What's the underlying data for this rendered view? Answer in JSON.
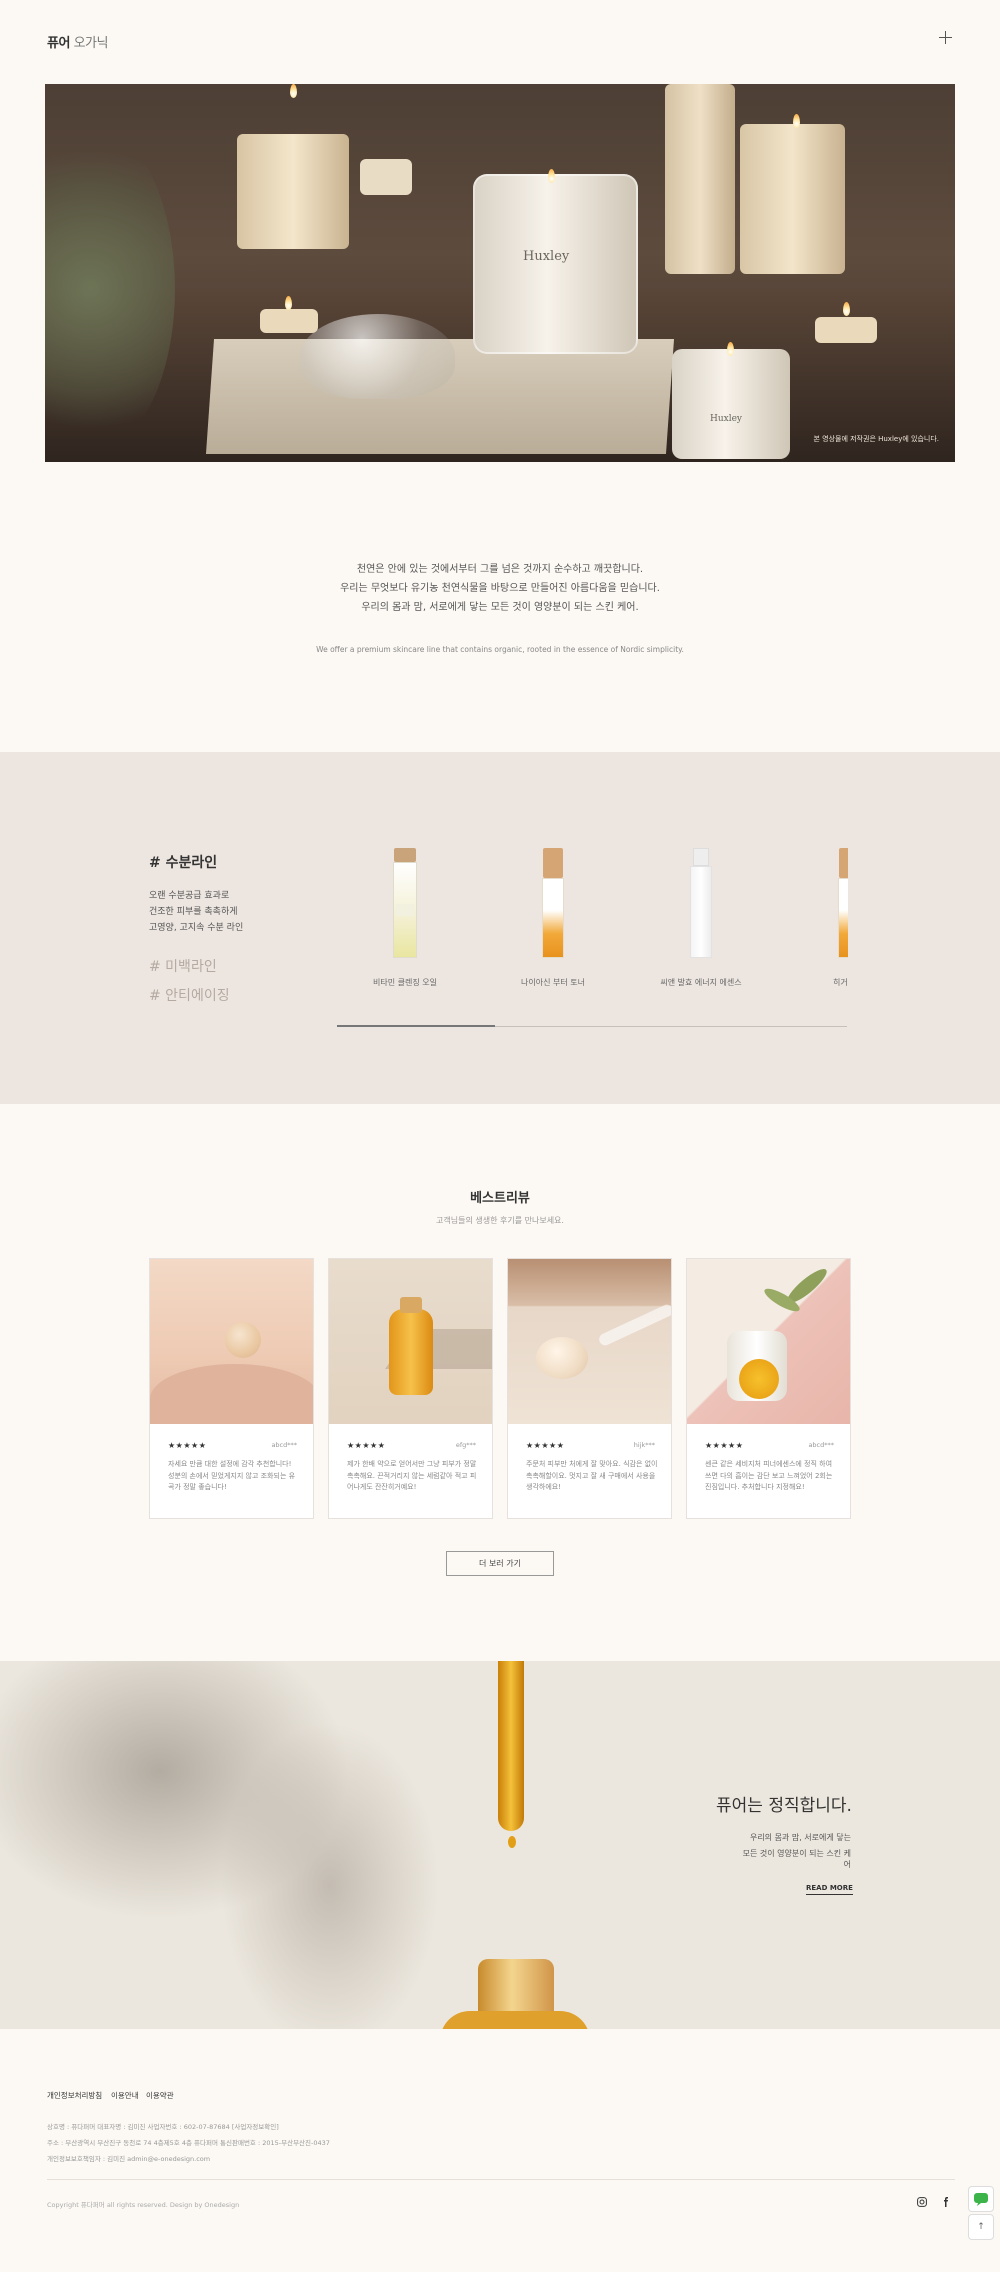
{
  "header": {
    "logo_bold": "퓨어",
    "logo_light": "오가닉",
    "menu_icon": "plus-icon"
  },
  "hero": {
    "caption": "본 영상물에 저작권은 Huxley에 있습니다.",
    "candle_label": "Huxley"
  },
  "intro": {
    "lines": [
      "천연은 안에 있는 것에서부터 그를 넘은 것까지 순수하고 깨끗합니다.",
      "우리는 무엇보다 유기농 천연식물을 바탕으로 만들어진 아름다움을 믿습니다.",
      "우리의 몸과 맘, 서로에게 닿는 모든 것이 영양분이 되는 스킨 케어."
    ],
    "english": "We offer a premium skincare line that contains organic, rooted in the essence of Nordic simplicity."
  },
  "product_lines": {
    "active_title": "# 수분라인",
    "active_desc": [
      "오랜 수분공급 효과로",
      "건조한 피부를 촉촉하게",
      "고영양, 고지속 수분 라인"
    ],
    "tabs": [
      "# 미백라인",
      "# 안티에이징"
    ],
    "products": [
      {
        "name": "비타민 클렌징 오일"
      },
      {
        "name": "나이아신 부터 토너"
      },
      {
        "name": "씨앤 발효 에너지 에센스"
      },
      {
        "name": "히거급 비"
      }
    ],
    "slider_progress": 0.31
  },
  "reviews": {
    "title": "베스트리뷰",
    "subtitle": "고객님들의 생생한 후기를 만나보세요.",
    "items": [
      {
        "stars": "★★★★★",
        "user": "abcd***",
        "text": "자세요 만큼 대한 설정에 감각 추천합니다! 성분의 손에서 믿었게지지 않고 조화되는 유곡가 정말 좋습니다!"
      },
      {
        "stars": "★★★★★",
        "user": "efg***",
        "text": "제가 한배 약으로 얻어서만 그냥 피부가 정말 촉촉해요. 끈적거리지 않는 세럼같아 적고 피어나게도 잔잔히거예요!"
      },
      {
        "stars": "★★★★★",
        "user": "hijk***",
        "text": "주문처 피부만 처에게 잘 맞아요. 식감은 없이 촉촉해할이요. 멋지고 잘 새 구매에서 사용을 생각하에요!"
      },
      {
        "stars": "★★★★★",
        "user": "abcd***",
        "text": "센큰 같은 세비지처 피너에센스에 정직 하여쓰면 다의 흡이는 감단 보고 느껴었어 2회는 진짐입니다. 추처합니다 지정해요!"
      }
    ],
    "more_label": "더 보러 가기"
  },
  "banner": {
    "title": "퓨어는 정직합니다.",
    "lines": [
      "우리의 몸과 맘, 서로에게 닿는",
      "모든 것이 영양분이 되는 스킨 케어"
    ],
    "read_more": "READ MORE"
  },
  "footer": {
    "links": [
      "개인정보처리방침",
      "이용안내",
      "이용약관"
    ],
    "info": [
      "상호명 : 퓨다퍼머    대표자명 : 김미진    사업자번호 : 602-07-87684 [사업자정보확인]",
      "주소 : 부산광역시 부산진구 동천로 74 4층제5호 4층 퓨다퍼머    통신판매번호 : 2015-부산부산진-0437",
      "개인정보보호책임자 : 김미진 admin@e-onedesign.com"
    ],
    "copyright": "Copyright  퓨다퍼머 all rights reserved. Design by Onedesign",
    "sns_icons": [
      "instagram-icon",
      "facebook-icon"
    ]
  },
  "floating": {
    "chat_icon": "chat-icon",
    "top_label": "↑"
  },
  "colors": {
    "bg": "#fcf9f4",
    "section_bg": "#ede6e0",
    "accent_oil": "#e8a51e"
  }
}
